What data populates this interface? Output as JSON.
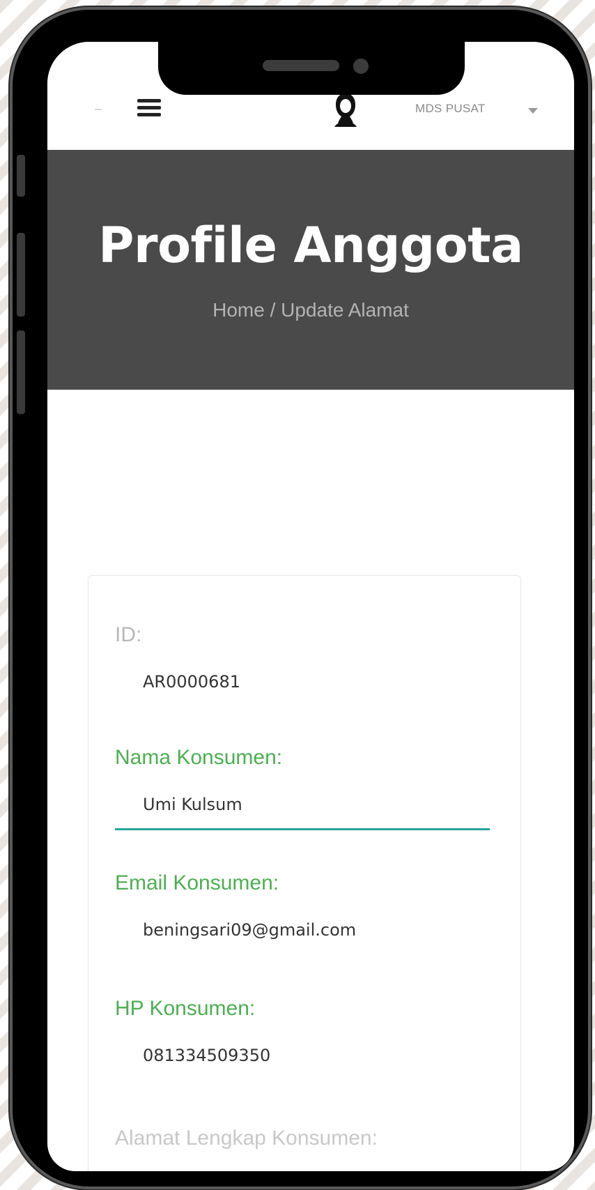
{
  "header": {
    "brand": "MDS PUSAT",
    "icons": {
      "menu": "hamburger-icon",
      "avatar": "user-hijab-icon",
      "dropdown": "caret-down-icon"
    }
  },
  "hero": {
    "title": "Profile Anggota",
    "breadcrumb": "Home / Update Alamat"
  },
  "form": {
    "id_label": "ID:",
    "id_value": "AR0000681",
    "nama_label": "Nama Konsumen:",
    "nama_value": "Umi Kulsum",
    "email_label": "Email Konsumen:",
    "email_value": "beningsari09@gmail.com",
    "hp_label": "HP Konsumen:",
    "hp_value": "081334509350",
    "alamat_label": "Alamat Lengkap Konsumen:"
  },
  "colors": {
    "hero_bg": "#4a4a4a",
    "label_green": "#4caf50",
    "focus_underline": "#26a69a"
  }
}
